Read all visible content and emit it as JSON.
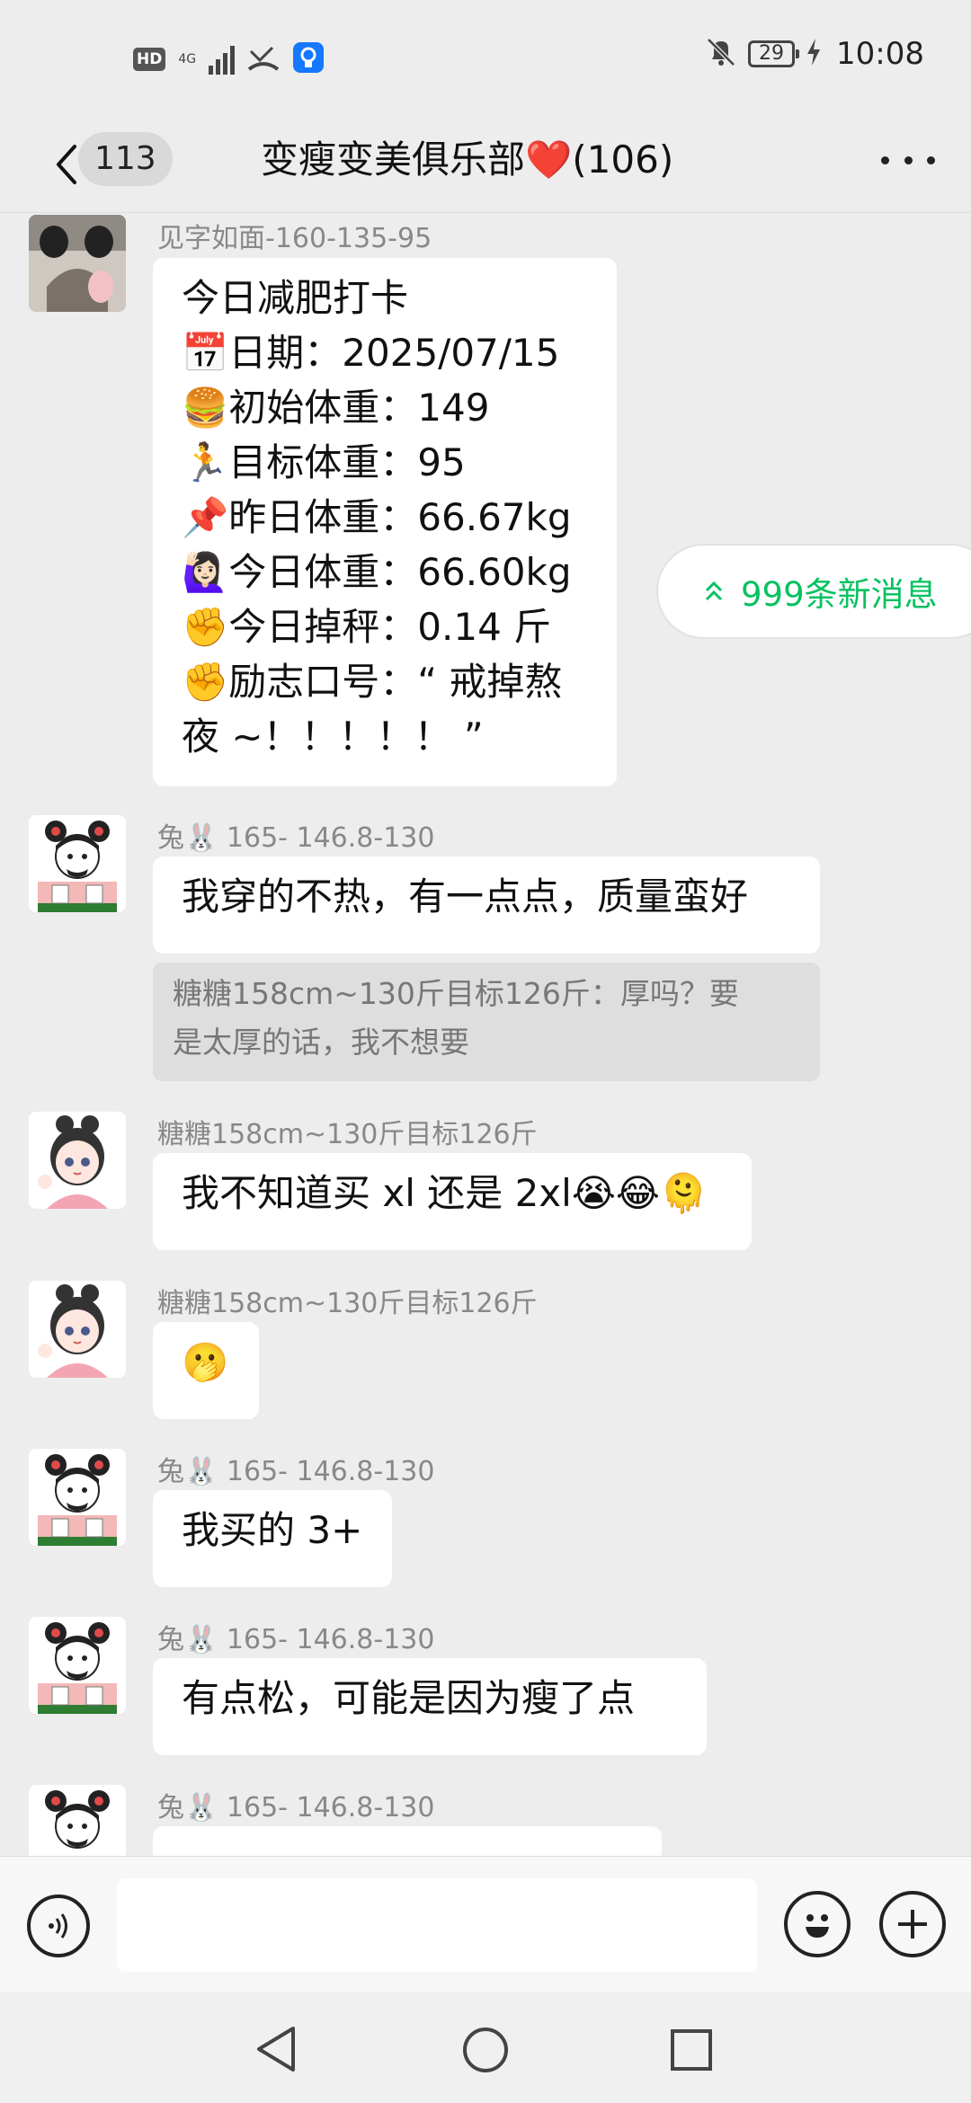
{
  "status_bar": {
    "hd_label": "HD",
    "network_label": "4G",
    "battery_level": "29",
    "time": "10:08"
  },
  "header": {
    "unread_count": "113",
    "title": "变瘦变美俱乐部❤️(106)"
  },
  "new_messages": {
    "label": "999条新消息"
  },
  "messages": [
    {
      "sender": "见字如面-160-135-95",
      "lines": [
        "今日减肥打卡",
        "📅日期：2025/07/15",
        "🍔初始体重：149",
        "🏃目标体重：95",
        "📌昨日体重：66.67kg",
        "🙋🏻‍♀️今日体重：66.60kg",
        "✊今日掉秤：0.14 斤",
        "✊励志口号：“ 戒掉熬",
        "夜 ~！！！！！ ”"
      ]
    },
    {
      "sender": "兔🐰 165- 146.8-130",
      "text": "我穿的不热，有一点点，质量蛮好",
      "quote": [
        "糖糖158cm~130斤目标126斤：厚吗？要",
        "是太厚的话，我不想要"
      ]
    },
    {
      "sender": "糖糖158cm~130斤目标126斤",
      "text": "我不知道买 xl 还是 2xl😭😂🫠"
    },
    {
      "sender": "糖糖158cm~130斤目标126斤",
      "text": "🫢"
    },
    {
      "sender": "兔🐰 165- 146.8-130",
      "text": "我买的 3+"
    },
    {
      "sender": "兔🐰 165- 146.8-130",
      "text": "有点松，可能是因为瘦了点"
    },
    {
      "sender": "兔🐰 165- 146.8-130",
      "text": ""
    }
  ],
  "colors": {
    "background": "#ededed",
    "accent_green": "#07c160",
    "bubble": "#ffffff",
    "quote_bg": "#dedede"
  },
  "icons": {
    "voice": "voice-icon",
    "emoji": "emoji-icon",
    "plus": "plus-icon",
    "back": "chevron-left-icon",
    "more": "more-icon"
  }
}
